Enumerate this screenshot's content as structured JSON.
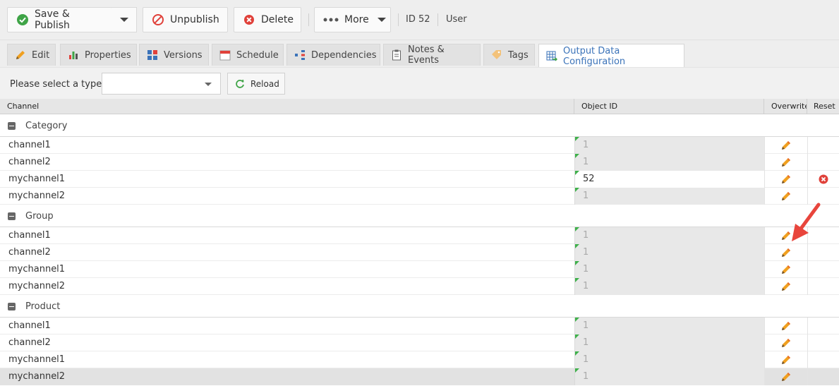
{
  "toolbar": {
    "save_publish": "Save & Publish",
    "unpublish": "Unpublish",
    "delete": "Delete",
    "more": "More",
    "id_label": "ID 52",
    "type_label": "User"
  },
  "tabs": [
    {
      "label": "Edit",
      "icon": "pencil-icon"
    },
    {
      "label": "Properties",
      "icon": "properties-icon"
    },
    {
      "label": "Versions",
      "icon": "versions-icon"
    },
    {
      "label": "Schedule",
      "icon": "calendar-icon"
    },
    {
      "label": "Dependencies",
      "icon": "dependencies-icon"
    },
    {
      "label": "Notes & Events",
      "icon": "clipboard-icon"
    },
    {
      "label": "Tags",
      "icon": "tag-icon"
    },
    {
      "label": "Output Data Configuration",
      "icon": "grid-export-icon",
      "active": true
    }
  ],
  "filter": {
    "label": "Please select a type",
    "select_value": "",
    "reload": "Reload"
  },
  "grid": {
    "headers": {
      "channel": "Channel",
      "object_id": "Object ID",
      "overwrite": "Overwrite",
      "reset": "Reset"
    },
    "groups": [
      {
        "name": "Category",
        "rows": [
          {
            "channel": "channel1",
            "object_id": "1",
            "editable": false,
            "reset": false
          },
          {
            "channel": "channel2",
            "object_id": "1",
            "editable": false,
            "reset": false
          },
          {
            "channel": "mychannel1",
            "object_id": "52",
            "editable": true,
            "reset": true
          },
          {
            "channel": "mychannel2",
            "object_id": "1",
            "editable": false,
            "reset": false
          }
        ]
      },
      {
        "name": "Group",
        "rows": [
          {
            "channel": "channel1",
            "object_id": "1",
            "editable": false,
            "reset": false
          },
          {
            "channel": "channel2",
            "object_id": "1",
            "editable": false,
            "reset": false
          },
          {
            "channel": "mychannel1",
            "object_id": "1",
            "editable": false,
            "reset": false
          },
          {
            "channel": "mychannel2",
            "object_id": "1",
            "editable": false,
            "reset": false
          }
        ]
      },
      {
        "name": "Product",
        "rows": [
          {
            "channel": "channel1",
            "object_id": "1",
            "editable": false,
            "reset": false
          },
          {
            "channel": "channel2",
            "object_id": "1",
            "editable": false,
            "reset": false
          },
          {
            "channel": "mychannel1",
            "object_id": "1",
            "editable": false,
            "reset": false
          },
          {
            "channel": "mychannel2",
            "object_id": "1",
            "editable": false,
            "reset": false,
            "selected": true
          }
        ]
      }
    ]
  },
  "colors": {
    "accent": "#3b73b9",
    "save_green": "#3fa447",
    "danger_red": "#e0413a",
    "pencil_orange": "#f0a020",
    "annotation_red": "#e8453c"
  }
}
